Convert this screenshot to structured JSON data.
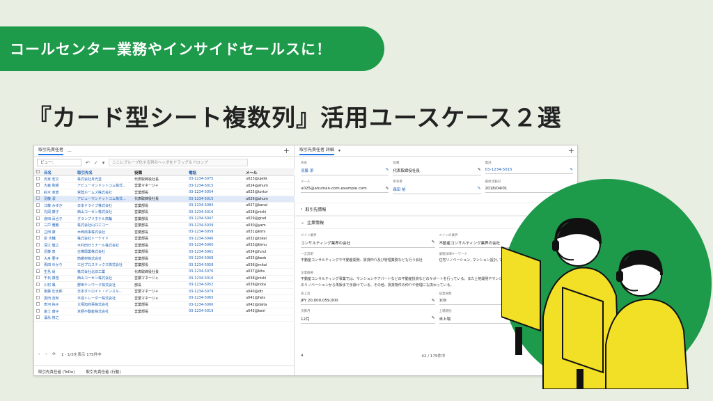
{
  "banner": "コールセンター業務やインサイドセールスに！",
  "title": "『カード型シート複数列』活用ユースケース２選",
  "left": {
    "tab": "取引先責任者",
    "tab_more": "...",
    "view_label": "ビュー：",
    "group_hint": "ここにグループ化する列のヘッダをドラッグ＆ドロップ",
    "columns": [
      "氏名",
      "取引先名",
      "役職",
      "電話",
      "メール"
    ],
    "rows": [
      [
        "氏家 宏文",
        "株式会社月光堂",
        "代表取締役社長",
        "03-1234-5075",
        "u023@ujekk"
      ],
      [
        "大森 和樹",
        "アビューマンドットコム株式...",
        "営業マネージャ",
        "03-1234-5015",
        "u024@ahum"
      ],
      [
        "鈴木 幸恵",
        "常陸ホームズ株式会社",
        "営業部長",
        "03-1234-5054",
        "u025@tortor"
      ],
      [
        "羽藤 潔",
        "アビューマンドットコム株式...",
        "代表取締役社長",
        "03-1234-5015",
        "u026@ahum"
      ],
      [
        "江藤 みゆき",
        "日本ドライブ株式会社",
        "営業部長",
        "03-1234-5084",
        "u027@kanal"
      ],
      [
        "丸岡 康子",
        "西山コーセン株式会社",
        "営業部長",
        "03-1234-5016",
        "u028@nishi"
      ],
      [
        "倉田 百合子",
        "グランプリホテル高輪",
        "営業部長",
        "03-1234-5047",
        "u029@grad"
      ],
      [
        "三戸 雅範",
        "株式会社山口エコー",
        "営業部長",
        "03-1234-5039",
        "u030@yam"
      ],
      [
        "立田 康",
        "木西商事株式会社",
        "営業部長",
        "03-1234-5059",
        "u031@kimi"
      ],
      [
        "泉 大輔",
        "株式会社トーケイド",
        "営業部長",
        "03-1234-5046",
        "u032@tokei"
      ],
      [
        "深江 健之",
        "木村田ゼミナール株式会社",
        "営業部長",
        "03-1234-5060",
        "u033@kimu"
      ],
      [
        "近藤 恵",
        "古樽興業株式会社",
        "営業部長",
        "03-1234-5061",
        "u034@furul"
      ],
      [
        "大舟 要子",
        "筒螺材株式会社",
        "営業部長",
        "03-1234-5068",
        "u035@kezb"
      ],
      [
        "馬田 ゆかり",
        "三谷プロステックス株式会社",
        "営業部長",
        "03-1234-5058",
        "u036@mitai"
      ],
      [
        "生島 尚",
        "株式会社北旧工業",
        "代表取締役社長",
        "03-1234-5076",
        "u037@kita"
      ],
      [
        "千石 康浩",
        "西山コーセン株式会社",
        "営業マネージャ",
        "03-1234-5016",
        "u038@nishi"
      ],
      [
        "川村 颯",
        "野田テンワーク株式会社",
        "部長",
        "03-1234-5052",
        "u039@nota"
      ],
      [
        "後藤 壮太郎",
        "日本ダトロイト・インスル...",
        "営業マネージャ",
        "03-1234-5079",
        "u040@dtr"
      ],
      [
        "黒田 吉秋",
        "平成トレーダー株式会社",
        "営業マネージャ",
        "03-1234-5065",
        "u041@heis"
      ],
      [
        "表河 祐子",
        "大塚旭商事株式会社",
        "営業部長",
        "03-1234-5066",
        "u042@daita"
      ],
      [
        "富士 康子",
        "京極不動産株式会社",
        "営業部長",
        "03-1234-5019",
        "u043@keiri"
      ],
      [
        "濱永 修之",
        "",
        "",
        "",
        ""
      ]
    ],
    "footer": "1 - 1/5を表示 175件中",
    "bottom_tabs": [
      "取引先責任者 (ToDo)",
      "取引先責任者 (行動)"
    ]
  },
  "right": {
    "tab": "取引先責任者 詳細",
    "fields_row1": [
      {
        "label": "氏名",
        "value": "羽藤 潔"
      },
      {
        "label": "役職",
        "value": "代表取締役社長"
      },
      {
        "label": "電話",
        "value": "03-1234-5015"
      }
    ],
    "fields_row2": [
      {
        "label": "メール",
        "value": "u025@ahuman-com.example.com"
      },
      {
        "label": "所有者",
        "value": "森田 裕"
      },
      {
        "label": "最終活動日",
        "value": "2018/04/01"
      }
    ],
    "section1": "取引先情報",
    "section2": "企業情報",
    "fields_row3": [
      {
        "label": "メイン業界",
        "value": "コンサルティング業界の会社"
      },
      {
        "label": "メインの業界",
        "value": "不動産コンサルティング業界の会社"
      }
    ],
    "fields_row4": [
      {
        "label": "一言説明",
        "value": "不動産コンサルティングや不動産開発、賃貸仲介及び管理業務なども行う会社"
      },
      {
        "label": "業態詳細キーワード",
        "value": "住宅リノベーション, マンション設計, マンション管理, 投資 コンサルティング, マン"
      }
    ],
    "summary_label": "企業概要",
    "summary": "不動産コンサルティング事業では、マンションやアパートなどの不動産投資などのサポートを行っている。また土地開発やマンション開発、開発業務も行っている。顧客向けのリノベーションから再販まで手掛けている。その他、賃貸物件の仲介や管理にも携わっている。",
    "fields_row5": [
      {
        "label": "売上高",
        "value": "JPY 20,000,059,000"
      },
      {
        "label": "従業員数",
        "value": "109"
      }
    ],
    "fields_row6": [
      {
        "label": "決算月",
        "value": "12月"
      },
      {
        "label": "上場期別",
        "value": "未上場"
      }
    ],
    "footer_left": "4",
    "footer_mid": "42 / 175件中"
  }
}
